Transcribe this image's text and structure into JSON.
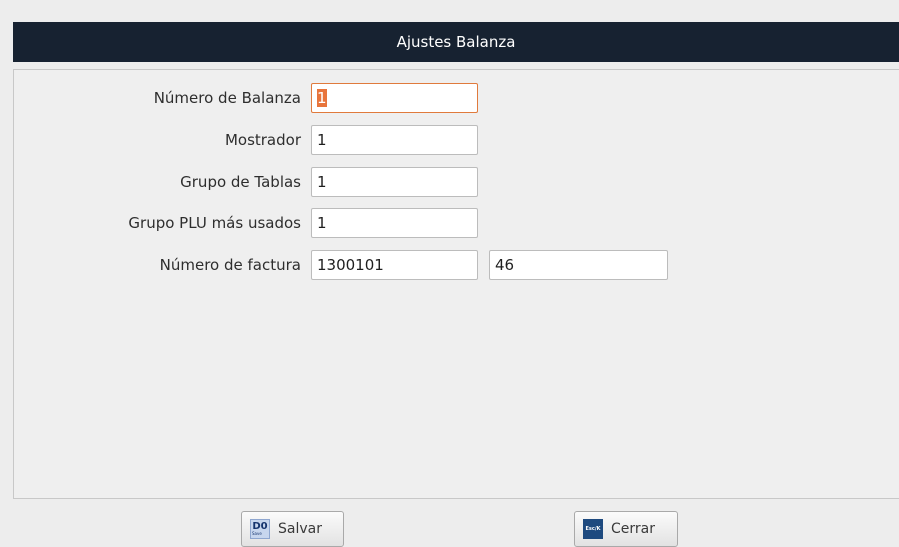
{
  "window": {
    "title": "Ajustes Balanza"
  },
  "form": {
    "scale_number": {
      "label": "Número de Balanza",
      "value": "1"
    },
    "counter": {
      "label": "Mostrador",
      "value": "1"
    },
    "table_group": {
      "label": "Grupo de Tablas",
      "value": "1"
    },
    "plu_group": {
      "label": "Grupo PLU más usados",
      "value": "1"
    },
    "invoice_number": {
      "label": "Número de factura",
      "value": "1300101",
      "value2": "46"
    }
  },
  "footer": {
    "save": {
      "icon_name": "save-icon",
      "icon_key": "D0",
      "icon_sub": "Save",
      "label": "Salvar"
    },
    "close": {
      "icon_name": "close-icon",
      "icon_key": "Esc/K",
      "label": "Cerrar"
    }
  },
  "colors": {
    "titlebar": "#172231",
    "focus_border": "#e07a3c",
    "selection": "#e8743b"
  }
}
